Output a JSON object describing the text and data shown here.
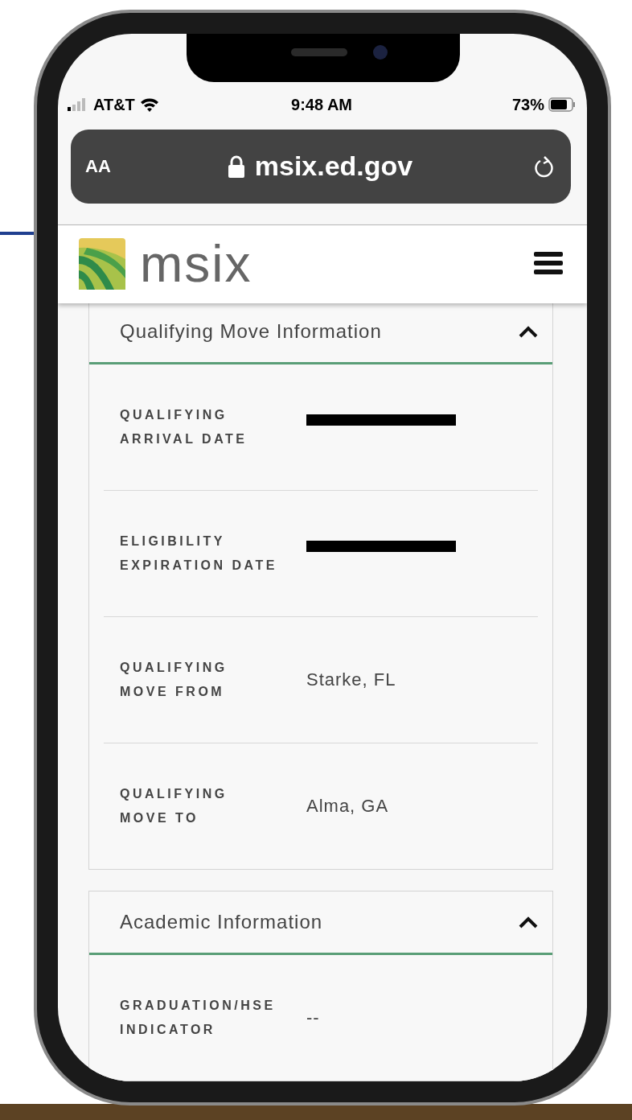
{
  "status_bar": {
    "carrier": "AT&T",
    "time": "9:48 AM",
    "battery": "73%"
  },
  "browser": {
    "text_size_button": "AA",
    "url": "msix.ed.gov"
  },
  "site_header": {
    "logo_text": "msix"
  },
  "sections": [
    {
      "title": "Qualifying Move Information",
      "expanded": true,
      "fields": [
        {
          "label": "QUALIFYING ARRIVAL DATE",
          "redacted": true
        },
        {
          "label": "ELIGIBILITY EXPIRATION DATE",
          "redacted": true
        },
        {
          "label": "QUALIFYING MOVE FROM",
          "value": "Starke, FL"
        },
        {
          "label": "QUALIFYING MOVE TO",
          "value": "Alma, GA"
        }
      ]
    },
    {
      "title": "Academic Information",
      "expanded": true,
      "fields": [
        {
          "label": "GRADUATION/HSE INDICATOR",
          "value": "--"
        }
      ]
    }
  ]
}
